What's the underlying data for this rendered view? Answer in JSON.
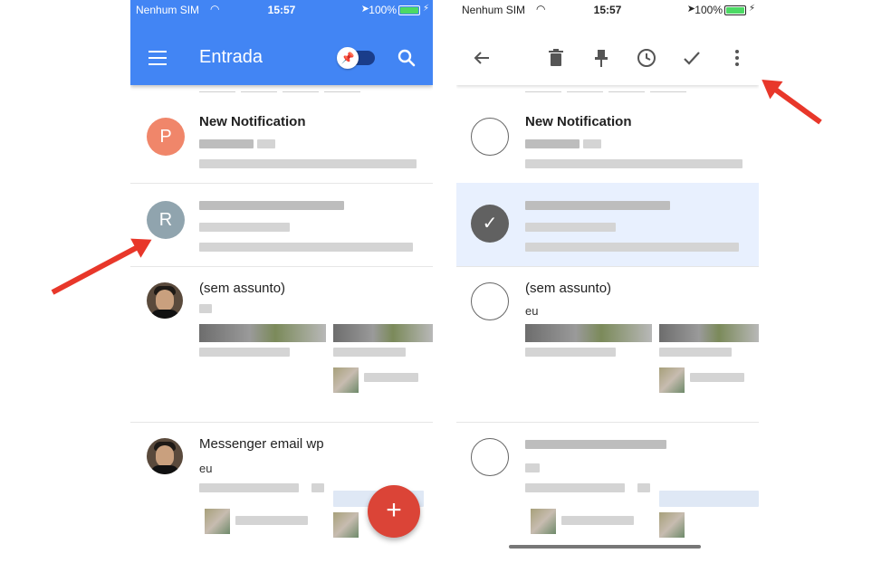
{
  "status_bar": {
    "carrier": "Nenhum SIM",
    "time": "15:57",
    "battery": "100%"
  },
  "colors": {
    "primary": "#4285f4",
    "fab": "#db4437",
    "selected_row": "#e8f0fe",
    "arrow": "#e8372a"
  },
  "left_screen": {
    "title": "Entrada",
    "icons": [
      "menu-icon",
      "pin-toggle-icon",
      "search-icon"
    ],
    "emails": [
      {
        "avatar_letter": "P",
        "avatar_color": "#f0866a",
        "subject": "New Notification",
        "bold": true
      },
      {
        "avatar_letter": "R",
        "avatar_color": "#90a4ae",
        "subject": "",
        "bold": false
      },
      {
        "subject": "(sem assunto)",
        "bold": false
      },
      {
        "subject": "Messenger email wp",
        "sender": "eu",
        "bold": false
      }
    ],
    "fab_label": "+"
  },
  "right_screen": {
    "toolbar_icons": [
      "back-arrow-icon",
      "delete-icon",
      "pin-icon",
      "snooze-clock-icon",
      "done-check-icon",
      "more-vert-icon"
    ],
    "emails": [
      {
        "subject": "New Notification",
        "bold": true,
        "selected": false
      },
      {
        "subject": "",
        "bold": false,
        "selected": true
      },
      {
        "subject": "(sem assunto)",
        "sender": "eu",
        "bold": false,
        "selected": false
      },
      {
        "subject": "",
        "bold": false,
        "selected": false
      }
    ]
  }
}
